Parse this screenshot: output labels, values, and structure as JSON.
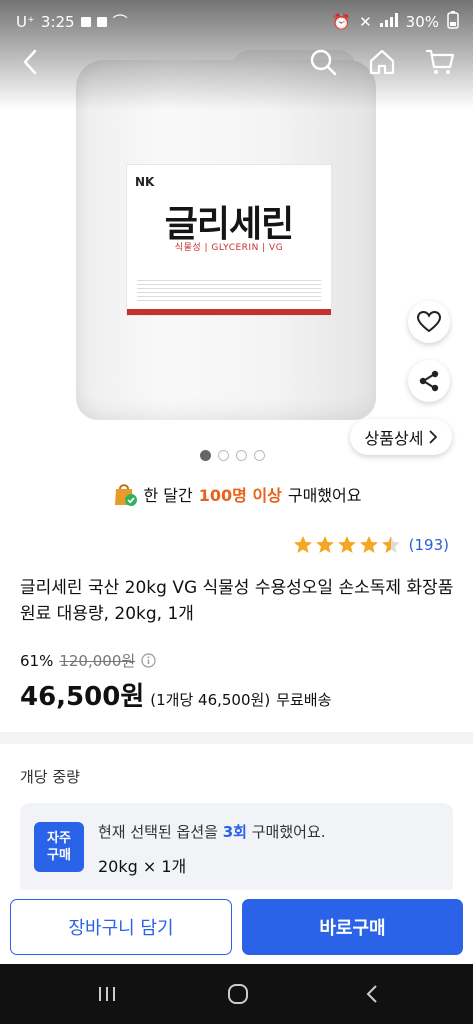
{
  "status": {
    "carrier": "U⁺",
    "time": "3:25",
    "battery": "30%"
  },
  "product_image": {
    "label_title": "글리세린",
    "label_subtitle": "식물성 | GLYCERIN | VG"
  },
  "floating": {
    "detail_label": "상품상세"
  },
  "pagination": {
    "total": 4,
    "active": 0
  },
  "notice": {
    "prefix": "한 달간",
    "highlight": "100명 이상",
    "suffix": "구매했어요"
  },
  "rating": {
    "stars": 4.5,
    "count": "(193)"
  },
  "product": {
    "title": "글리세린 국산 20kg VG 식물성 수용성오일 손소독제 화장품원료 대용량, 20kg, 1개",
    "discount": "61%",
    "original_price": "120,000원",
    "price": "46,500원",
    "unit_price": "(1개당 46,500원)",
    "shipping": "무료배송"
  },
  "options": {
    "heading": "개당 중량",
    "badge_line1": "자주",
    "badge_line2": "구매",
    "msg_prefix": "현재 선택된 옵션을",
    "msg_highlight": "3회",
    "msg_suffix": "구매했어요.",
    "selected": "20kg × 1개"
  },
  "actions": {
    "cart": "장바구니 담기",
    "buy": "바로구매"
  },
  "colors": {
    "accent_blue": "#2a63e8",
    "highlight_orange": "#e8621a",
    "star": "#f5a623",
    "label_red": "#c6312c"
  }
}
